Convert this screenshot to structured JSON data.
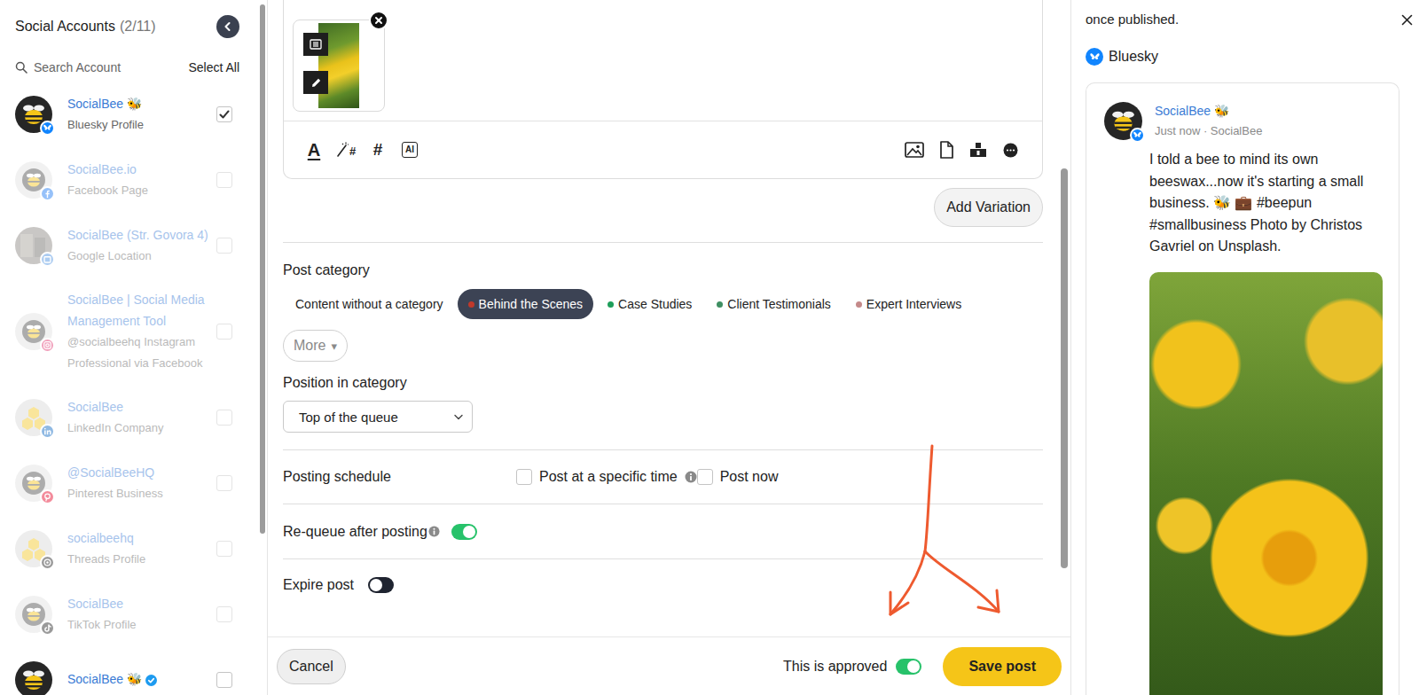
{
  "sidebar": {
    "title": "Social Accounts",
    "count": "(2/11)",
    "search": {
      "placeholder": "Search Account"
    },
    "select_all": "Select All",
    "accounts": [
      {
        "name": "SocialBee 🐝",
        "subtitle": "Bluesky Profile",
        "network": "bluesky",
        "color": "#1185fe",
        "avatar": "bee-dark",
        "checked": true,
        "dimmed": false,
        "verified": false
      },
      {
        "name": "SocialBee.io",
        "subtitle": "Facebook Page",
        "network": "facebook",
        "color": "#1877f2",
        "avatar": "bee-light",
        "checked": false,
        "dimmed": true,
        "verified": false
      },
      {
        "name": "SocialBee (Str. Govora 4)",
        "subtitle": "Google Location",
        "network": "google",
        "color": "#4a90e2",
        "avatar": "photo",
        "checked": false,
        "dimmed": true,
        "verified": false
      },
      {
        "name": "SocialBee | Social Media Management Tool",
        "subtitle": "@socialbeehq Instagram Professional via Facebook",
        "network": "instagram",
        "color": "#e1306c",
        "avatar": "bee-light",
        "checked": false,
        "dimmed": true,
        "verified": false
      },
      {
        "name": "SocialBee",
        "subtitle": "LinkedIn Company",
        "network": "linkedin",
        "color": "#0a66c2",
        "avatar": "honeycomb",
        "checked": false,
        "dimmed": true,
        "verified": false
      },
      {
        "name": "@SocialBeeHQ",
        "subtitle": "Pinterest Business",
        "network": "pinterest",
        "color": "#e60023",
        "avatar": "bee-light",
        "checked": false,
        "dimmed": true,
        "verified": false
      },
      {
        "name": "socialbeehq",
        "subtitle": "Threads Profile",
        "network": "threads",
        "color": "#222222",
        "avatar": "honeycomb",
        "checked": false,
        "dimmed": true,
        "verified": false
      },
      {
        "name": "SocialBee",
        "subtitle": "TikTok Profile",
        "network": "tiktok",
        "color": "#222222",
        "avatar": "bee-light",
        "checked": false,
        "dimmed": true,
        "verified": false
      },
      {
        "name": "SocialBee 🐝",
        "network": "none",
        "avatar": "bee-dark",
        "checked": false,
        "dimmed": false,
        "verified": true
      }
    ]
  },
  "editor": {
    "toolbar": [
      {
        "kind": "format",
        "glyph": "A"
      },
      {
        "kind": "smart-hashtag",
        "glyph": "#"
      },
      {
        "kind": "hashtag",
        "glyph": "#"
      },
      {
        "kind": "ai",
        "glyph": "AI"
      }
    ],
    "add_variation": "Add Variation"
  },
  "post_category": {
    "label": "Post category",
    "chips": [
      {
        "label": "Content without a category",
        "selected": false
      },
      {
        "label": "Behind the Scenes",
        "selected": true,
        "color": "#c0392b"
      },
      {
        "label": "Case Studies",
        "selected": false,
        "color": "#1e9e5a"
      },
      {
        "label": "Client Testimonials",
        "selected": false,
        "color": "#3f8f62"
      },
      {
        "label": "Expert Interviews",
        "selected": false,
        "color": "#c48a8a"
      }
    ],
    "more": {
      "label": "More",
      "caret": "▾"
    }
  },
  "position": {
    "label": "Position in category",
    "value": "Top of the queue"
  },
  "schedule": {
    "label": "Posting schedule",
    "options": [
      {
        "label": "Post at a specific time",
        "checked": false,
        "info": true
      },
      {
        "label": "Post now",
        "checked": false,
        "info": false
      }
    ]
  },
  "requeue": {
    "label": "Re-queue after posting",
    "info": true,
    "on": true
  },
  "expire": {
    "label": "Expire post",
    "on": false
  },
  "footer": {
    "cancel": "Cancel",
    "approved": {
      "label": "This is approved",
      "on": true
    },
    "save": "Save post"
  },
  "preview": {
    "note": "once published.",
    "network": "Bluesky",
    "post": {
      "author": "SocialBee 🐝",
      "meta": "Just now · SocialBee",
      "text": "I told a bee to mind its own beeswax...now it's starting a small business. 🐝 💼 #beepun #smallbusiness Photo by Christos Gavriel on Unsplash."
    }
  }
}
